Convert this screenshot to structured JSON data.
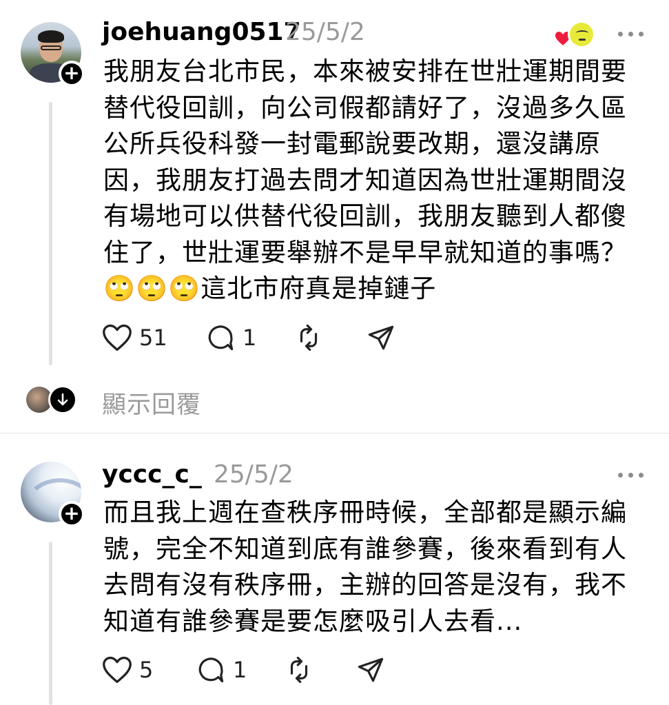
{
  "posts": [
    {
      "username": "joehuang0517",
      "timestamp": "25/5/2",
      "text": "我朋友台北市民，本來被安排在世壯運期間要\n替代役回訓，向公司假都請好了，沒過多久區\n公所兵役科發一封電郵說要改期，還沒講原\n因，我朋友打過去問才知道因為世壯運期間沒\n有場地可以供替代役回訓，我朋友聽到人都傻\n住了，世壯運要舉辦不是早早就知道的事嗎？\n🙄🙄🙄這北市府真是掉鏈子",
      "likes": "51",
      "replies": "1",
      "reactions_icons": [
        "heart-icon",
        "sticker-face-icon"
      ],
      "show_replies_label": "顯示回覆"
    },
    {
      "username": "yccc_c_",
      "timestamp": "25/5/2",
      "text": "而且我上週在查秩序冊時候，全部都是顯示編\n號，完全不知道到底有誰參賽，後來看到有人\n去問有沒有秩序冊，主辦的回答是沒有，我不\n知道有誰參賽是要怎麼吸引人去看...",
      "likes": "5",
      "replies": "1"
    }
  ],
  "follow_badge_symbol": "+",
  "colors": {
    "text": "#000000",
    "secondary": "#9a9a9a",
    "thread_line": "#e2e2e2",
    "heart_red": "#ee1c3f",
    "sticker_yellow": "#e8ea3a"
  },
  "icons": [
    "heart-icon",
    "comment-icon",
    "repost-icon",
    "share-icon",
    "more-icon",
    "plus-icon",
    "down-arrow-icon"
  ]
}
